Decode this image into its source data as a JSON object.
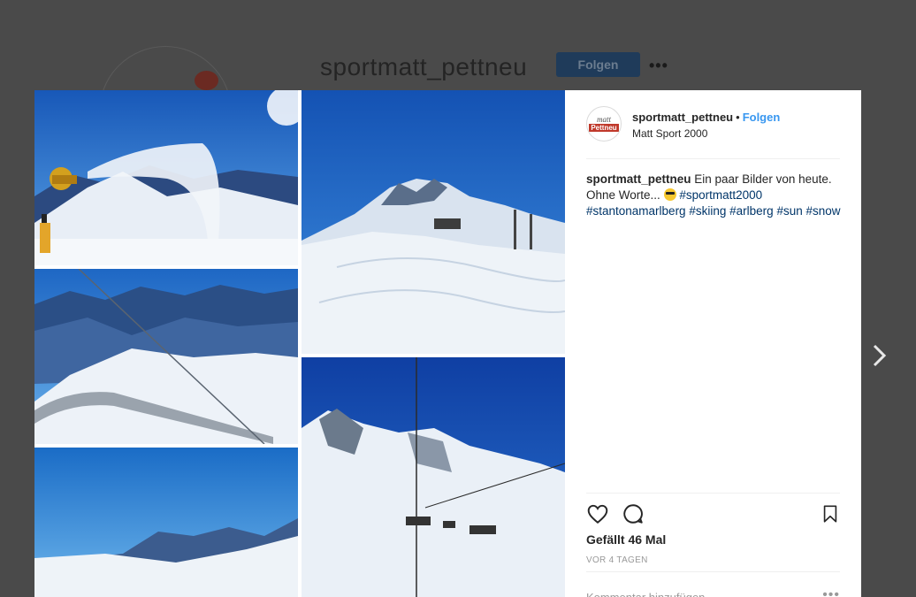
{
  "background": {
    "username": "sportmatt_pettneu",
    "follow_label": "Folgen",
    "more_label": "•••"
  },
  "post": {
    "header": {
      "username": "sportmatt_pettneu",
      "separator": "•",
      "follow_label": "Folgen",
      "subtitle": "Matt Sport 2000",
      "avatar_text_top": "matt",
      "avatar_text_bottom": "Pettneu"
    },
    "caption": {
      "username": "sportmatt_pettneu",
      "text_1": " Ein paar Bilder von heute. Ohne Worte... ",
      "hashtags": [
        "#sportmatt2000",
        "#stantonamarlberg",
        "#skiing",
        "#arlberg",
        "#sun",
        "#snow"
      ]
    },
    "likes": "Gefällt 46 Mal",
    "time": "VOR 4 TAGEN",
    "comment_placeholder": "Kommentar hinzufügen ...",
    "comment_more": "•••"
  },
  "icons": {
    "like": "heart-icon",
    "comment": "comment-icon",
    "save": "bookmark-icon",
    "next": "chevron-right-icon"
  },
  "colors": {
    "link_blue": "#3897f0",
    "hashtag": "#003569",
    "sky": "#1f6fc4"
  }
}
